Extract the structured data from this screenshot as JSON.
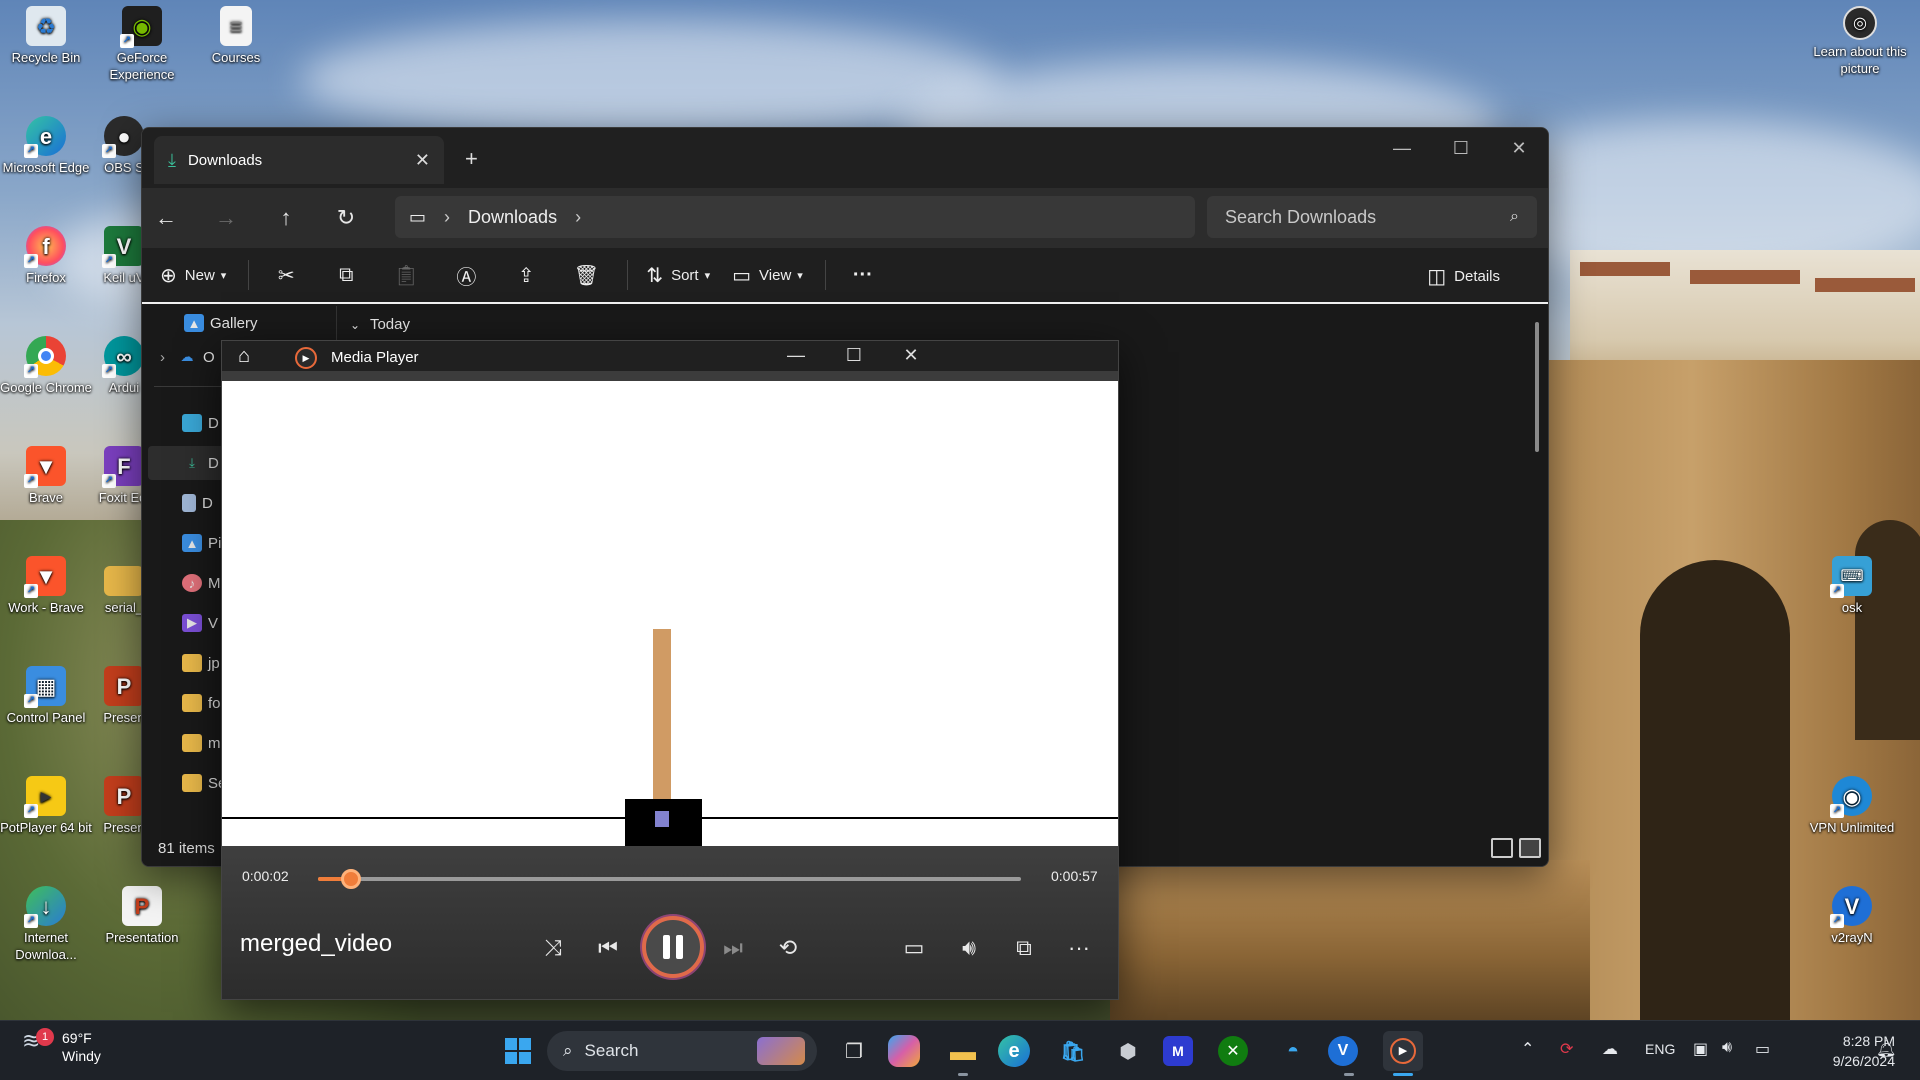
{
  "desktop": {
    "icons": [
      {
        "label": "Recycle Bin",
        "icon": "recycle-bin-icon"
      },
      {
        "label": "GeForce Experience",
        "icon": "geforce-icon"
      },
      {
        "label": "Courses",
        "icon": "document-icon"
      },
      {
        "label": "Microsoft Edge",
        "icon": "edge-icon"
      },
      {
        "label": "OBS S",
        "icon": "obs-icon"
      },
      {
        "label": "Firefox",
        "icon": "firefox-icon"
      },
      {
        "label": "Keil uV",
        "icon": "keil-icon"
      },
      {
        "label": "Google Chrome",
        "icon": "chrome-icon"
      },
      {
        "label": "Ardui",
        "icon": "arduino-icon"
      },
      {
        "label": "Brave",
        "icon": "brave-icon"
      },
      {
        "label": "Foxit Edi",
        "icon": "foxit-icon"
      },
      {
        "label": "Work - Brave",
        "icon": "brave-icon"
      },
      {
        "label": "serial_",
        "icon": "folder-icon"
      },
      {
        "label": "Control Panel",
        "icon": "control-panel-icon"
      },
      {
        "label": "Presen",
        "icon": "powerpoint-icon"
      },
      {
        "label": "PotPlayer 64 bit",
        "icon": "potplayer-icon"
      },
      {
        "label": "Presen",
        "icon": "powerpoint-icon"
      },
      {
        "label": "Internet Downloa...",
        "icon": "idm-icon"
      },
      {
        "label": "Presentation",
        "icon": "powerpoint-icon"
      },
      {
        "label": "Learn about this picture",
        "icon": "camera-icon"
      },
      {
        "label": "osk",
        "icon": "keyboard-icon"
      },
      {
        "label": "VPN Unlimited",
        "icon": "vpn-icon"
      },
      {
        "label": "v2rayN",
        "icon": "v2rayn-icon"
      }
    ]
  },
  "explorer": {
    "tab_title": "Downloads",
    "address": [
      "Downloads"
    ],
    "search_placeholder": "Search Downloads",
    "toolbar": {
      "new_label": "New",
      "sort_label": "Sort",
      "view_label": "View",
      "details_label": "Details"
    },
    "sidebar": {
      "gallery": "Gallery",
      "onedrive": "O",
      "items": [
        "D",
        "D",
        "D",
        "Pi",
        "M",
        "V",
        "jp",
        "fo",
        "m",
        "Se"
      ]
    },
    "group_header": "Today",
    "status_count": "81 items"
  },
  "media_player": {
    "app_title": "Media Player",
    "current_time": "0:00:02",
    "total_time": "0:00:57",
    "progress": 0.047,
    "file_name": "merged_video"
  },
  "taskbar": {
    "weather": {
      "temp": "69°F",
      "condition": "Windy",
      "badge": "1"
    },
    "search_placeholder": "Search",
    "tray": {
      "language": "ENG"
    },
    "clock": {
      "time": "8:28 PM",
      "date": "9/26/2024"
    }
  },
  "colors": {
    "accent_orange": "#f07d3a",
    "explorer_bg": "#191919",
    "taskbar_bg": "#1e2228"
  }
}
